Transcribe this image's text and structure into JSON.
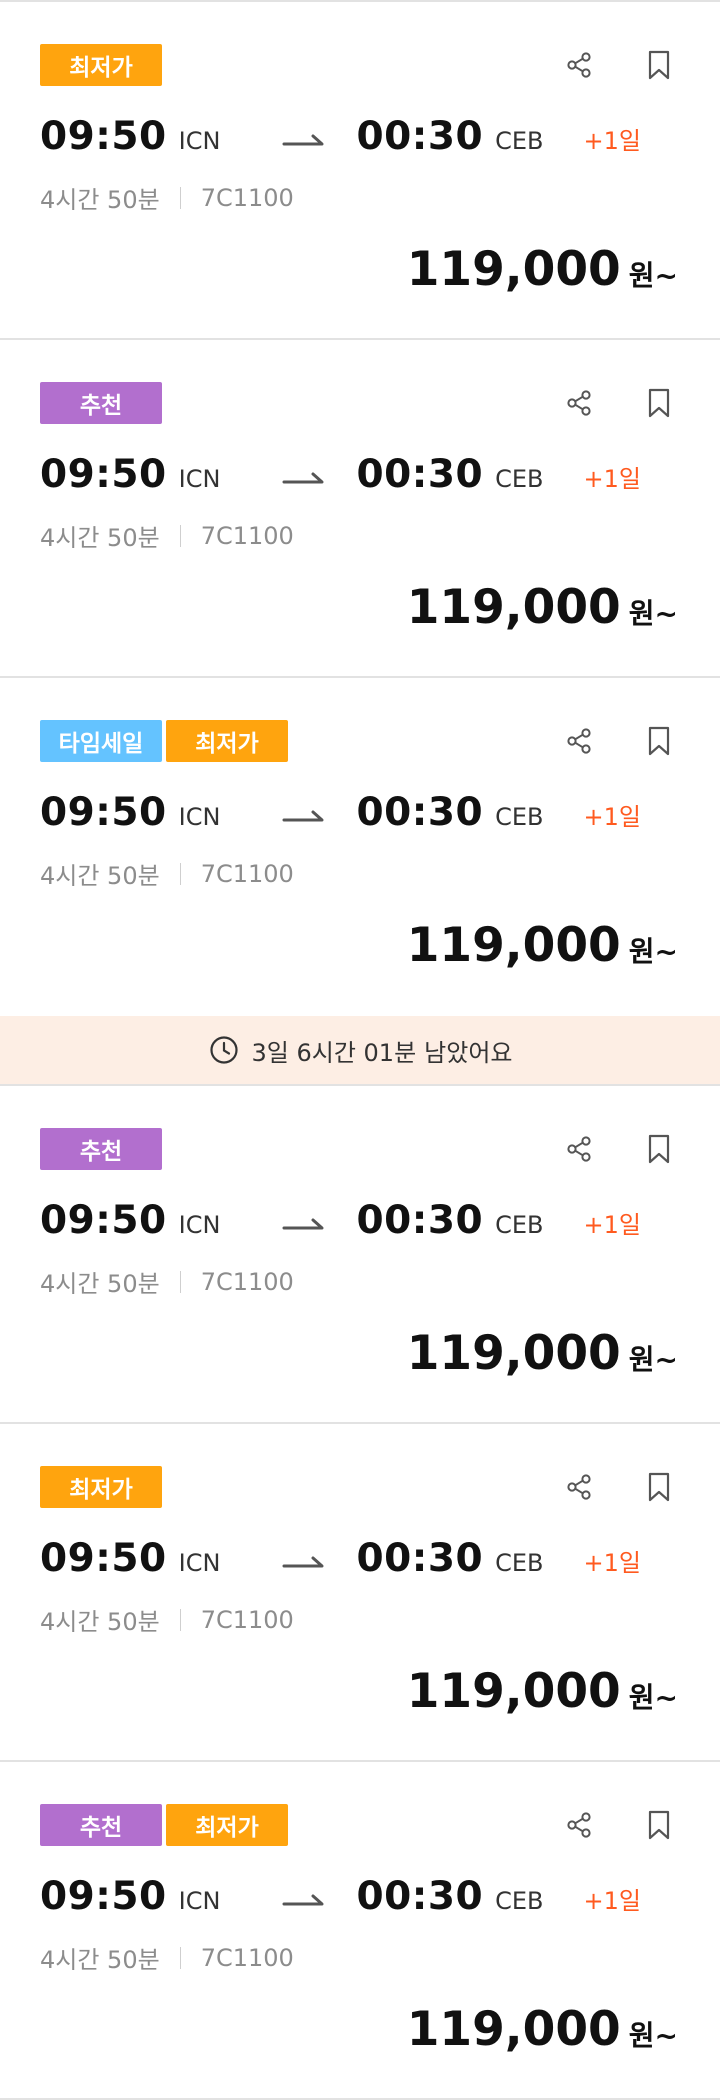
{
  "cards": [
    {
      "tags": [
        {
          "label": "최저가",
          "kind": "lowest"
        }
      ],
      "dep_time": "09:50",
      "dep_code": "ICN",
      "arr_time": "00:30",
      "arr_code": "CEB",
      "day_plus": "+1일",
      "duration": "4시간 50분",
      "flight_no": "7C1100",
      "price": "119,000",
      "currency": "원~",
      "icons": [
        "share-icon",
        "bookmark-icon",
        "arrow-icon"
      ]
    },
    {
      "tags": [
        {
          "label": "추천",
          "kind": "recommend"
        }
      ],
      "dep_time": "09:50",
      "dep_code": "ICN",
      "arr_time": "00:30",
      "arr_code": "CEB",
      "day_plus": "+1일",
      "duration": "4시간 50분",
      "flight_no": "7C1100",
      "price": "119,000",
      "currency": "원~"
    },
    {
      "tags": [
        {
          "label": "타임세일",
          "kind": "timesale"
        },
        {
          "label": "최저가",
          "kind": "lowest"
        }
      ],
      "dep_time": "09:50",
      "dep_code": "ICN",
      "arr_time": "00:30",
      "arr_code": "CEB",
      "day_plus": "+1일",
      "duration": "4시간 50분",
      "flight_no": "7C1100",
      "price": "119,000",
      "currency": "원~",
      "timer": {
        "remaining": "3일 6시간 01분",
        "suffix": "남았어요",
        "icon": "clock-icon"
      }
    },
    {
      "tags": [
        {
          "label": "추천",
          "kind": "recommend"
        }
      ],
      "dep_time": "09:50",
      "dep_code": "ICN",
      "arr_time": "00:30",
      "arr_code": "CEB",
      "day_plus": "+1일",
      "duration": "4시간 50분",
      "flight_no": "7C1100",
      "price": "119,000",
      "currency": "원~"
    },
    {
      "tags": [
        {
          "label": "최저가",
          "kind": "lowest"
        }
      ],
      "dep_time": "09:50",
      "dep_code": "ICN",
      "arr_time": "00:30",
      "arr_code": "CEB",
      "day_plus": "+1일",
      "duration": "4시간 50분",
      "flight_no": "7C1100",
      "price": "119,000",
      "currency": "원~"
    },
    {
      "tags": [
        {
          "label": "추천",
          "kind": "recommend"
        },
        {
          "label": "최저가",
          "kind": "lowest"
        }
      ],
      "dep_time": "09:50",
      "dep_code": "ICN",
      "arr_time": "00:30",
      "arr_code": "CEB",
      "day_plus": "+1일",
      "duration": "4시간 50분",
      "flight_no": "7C1100",
      "price": "119,000",
      "currency": "원~"
    }
  ],
  "colors": {
    "lowest_tag": "#ffa40e",
    "recommend_tag": "#b26fce",
    "timesale_tag": "#64c3ff",
    "day_plus": "#ff5a1f",
    "timer_bg": "#fdeee4"
  }
}
